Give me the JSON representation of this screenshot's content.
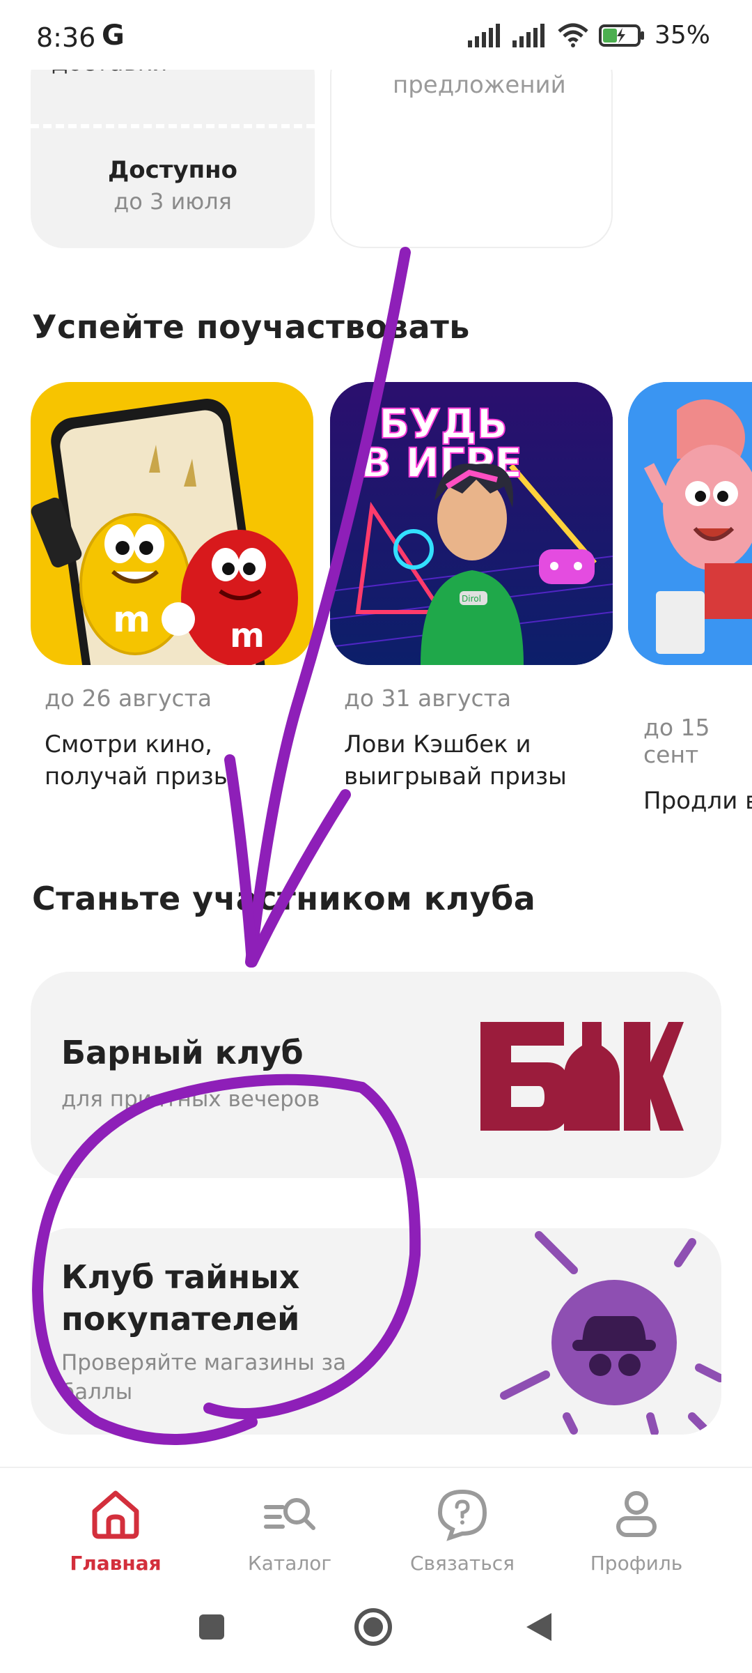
{
  "status_bar": {
    "time": "8:36",
    "carrier_icon": "G",
    "battery_percent": "35%"
  },
  "top_cards": {
    "left_cut_text": "доставки",
    "left_status": "Доступно",
    "left_date": "до 3 июля",
    "right_cut_text": "предложений"
  },
  "promos": {
    "section_title": "Успейте поучаствовать",
    "items": [
      {
        "date": "до 26 августа",
        "title": "Смотри кино,\nполучай призы",
        "image_icon": "mms-characters-image"
      },
      {
        "date": "до 31 августа",
        "title": "Лови Кэшбек и\nвыигрывай призы",
        "image_icon": "gamer-character-image",
        "image_text_line1": "БУДЬ",
        "image_text_line2": "В ИГРЕ",
        "image_badge": "Dirol"
      },
      {
        "date": "до 15 сент",
        "title": "Продли в",
        "image_icon": "mascot-character-image"
      }
    ]
  },
  "clubs": {
    "section_title": "Станьте участником клуба",
    "items": [
      {
        "title": "Барный клуб",
        "subtitle": "для приятных вечеров",
        "logo_text": "БК",
        "logo_color": "#9b1c3c"
      },
      {
        "title_line1": "Клуб тайных",
        "title_line2": "покупателей",
        "subtitle_line1": "Проверяйте магазины за",
        "subtitle_line2": "баллы",
        "icon": "secret-shopper-icon",
        "accent": "#8e4fb2"
      }
    ]
  },
  "bottom_nav": {
    "items": [
      {
        "label": "Главная",
        "icon": "home-icon",
        "active": true
      },
      {
        "label": "Каталог",
        "icon": "catalog-search-icon",
        "active": false
      },
      {
        "label": "Связаться",
        "icon": "help-chat-icon",
        "active": false
      },
      {
        "label": "Профиль",
        "icon": "profile-icon",
        "active": false
      }
    ],
    "active_color": "#d32f3c",
    "inactive_color": "#9a9a9a"
  },
  "annotation": {
    "color": "#8e1fb8",
    "shapes": [
      "arrow",
      "circle"
    ]
  }
}
